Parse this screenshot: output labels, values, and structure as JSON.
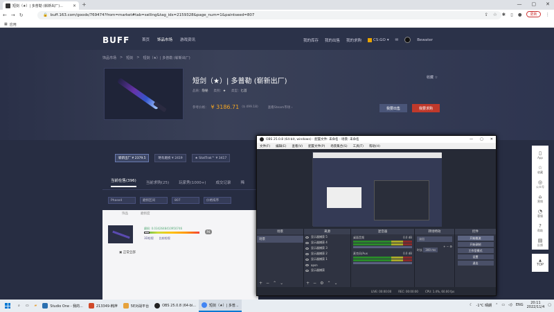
{
  "browser": {
    "tab_title": "短剑（★）| 多普勒 (崭新出厂)...",
    "url": "buff.163.com/goods/769474?from=market#tab=selling&tag_ids=2159328&page_num=1&paintseed=807",
    "update_label": "更新",
    "bookmark_label": "应用"
  },
  "site": {
    "logo": "BUFF",
    "nav": [
      "首页",
      "饰品市场",
      "游戏资讯"
    ],
    "nav_right": [
      "我的库存",
      "我的出售",
      "我的求购"
    ],
    "game": "CS:GO",
    "username": "Bewater"
  },
  "item": {
    "breadcrumb": [
      "饰品市场",
      ">",
      "短剑",
      ">",
      "短剑（★）| 多普勒 (崭新出厂)"
    ],
    "title": "短剑（★）| 多普勒 (崭新出厂)",
    "meta": [
      {
        "k": "品质：",
        "v": "隐秘"
      },
      {
        "k": "类别：",
        "v": "★"
      },
      {
        "k": "类型：",
        "v": "匕首"
      }
    ],
    "ref_label": "参考价格：",
    "price": "¥ 3186.71",
    "price_usd": "($ 499.18)",
    "steam_link": "查看Steam市场 ›",
    "favorite": "收藏 ☆",
    "buy_label": "我要出售",
    "sell_label": "我要求购"
  },
  "variants": [
    {
      "label": "崭新出厂 ¥ 2379.5",
      "active": true
    },
    {
      "label": "略有磨损 ¥ 2419",
      "active": false
    },
    {
      "label": "★ StatTrak™ ¥ 3417",
      "active": false
    }
  ],
  "tabs": [
    "当前在售(396)",
    "当前求购(25)",
    "玩家秀(1000+)",
    "成交记录",
    "稀"
  ],
  "filters": [
    "Phase4",
    "磨损区间",
    "807",
    "价格排序"
  ],
  "listing": {
    "headers": [
      "饰品",
      "磨损度"
    ],
    "wear": "磨损: 0.0342648410950746",
    "badge": "P4",
    "actions": [
      "3D检视",
      "比较检视"
    ],
    "footer": "正常全部"
  },
  "sidebar": [
    "App",
    "收藏",
    "公众号",
    "营销",
    "客服",
    "帮助",
    "反馈"
  ],
  "top_label": "TOP",
  "obs": {
    "title": "OBS 25.0.8 (64-bit, windows) - 配置文件: 未命名 - 场景: 未命名",
    "menu": [
      "文件(F)",
      "编辑(E)",
      "查看(V)",
      "配置文件(P)",
      "场景集合(S)",
      "工具(T)",
      "帮助(H)"
    ],
    "docks": [
      "场景",
      "来源",
      "混音器",
      "转场特效",
      "控件"
    ],
    "scene": "场景",
    "sources": [
      "显示器捕获 5",
      "显示器捕获 4",
      "显示器捕获 3",
      "显示器捕获 2",
      "显示器捕获 1",
      "apsn",
      "显示器捕获"
    ],
    "mixer": [
      {
        "name": "桌面音频",
        "db": "0.0 dB"
      },
      {
        "name": "麦克风/Aux",
        "db": "0.0 dB"
      }
    ],
    "transition": "淡出",
    "duration_label": "时长",
    "duration": "300 ms",
    "controls": [
      "开始推流",
      "开始录制",
      "工作室模式",
      "设置",
      "退出"
    ],
    "status": [
      "LIVE: 00:00:00",
      "REC: 00:00:00",
      "CPU: 1.4%, 60.00 fps"
    ]
  },
  "taskbar": {
    "apps": [
      {
        "label": "Studio One - 我的...",
        "color": "#2a6fb0"
      },
      {
        "label": "213349-韩萍",
        "color": "#d04a2a"
      },
      {
        "label": "5E对战平台",
        "color": "#e6a23c"
      },
      {
        "label": "OBS 25.0.8 (64-bi...",
        "color": "#222"
      },
      {
        "label": "短剑（★）| 多普...",
        "color": "#4285f4"
      }
    ],
    "weather": "-1°C 晴朗",
    "lang": "ENG",
    "time": "20:11",
    "date": "2022/11/4"
  }
}
